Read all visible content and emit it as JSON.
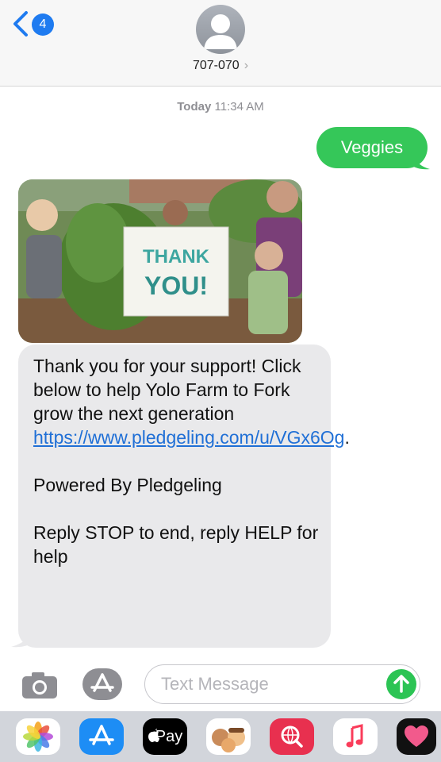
{
  "header": {
    "back_badge": "4",
    "contact": "707-070",
    "chevron": "›"
  },
  "thread": {
    "timestamp_day": "Today",
    "timestamp_time": "11:34 AM",
    "sent_message": "Veggies",
    "image_sign_text": "THANK YOU!",
    "received": {
      "line1": "Thank you for your support! Click below to help Yolo Farm to Fork grow the next generation ",
      "link": "https://www.pledgeling.com/u/VGx6Og",
      "link_suffix": ".",
      "powered": "Powered By Pledgeling",
      "reply": "Reply STOP to end, reply HELP for help"
    }
  },
  "compose": {
    "placeholder": "Text Message"
  },
  "app_strip": {
    "apple_pay_label": "Pay",
    "apps": [
      "photos-icon",
      "app-store-icon",
      "apple-pay-icon",
      "memoji-icon",
      "search-images-icon",
      "music-icon",
      "heart-app-icon"
    ]
  },
  "colors": {
    "sent_bubble": "#35c759",
    "received_bubble": "#e9e9eb",
    "link": "#1f6fd6",
    "badge": "#1f7bf0"
  }
}
